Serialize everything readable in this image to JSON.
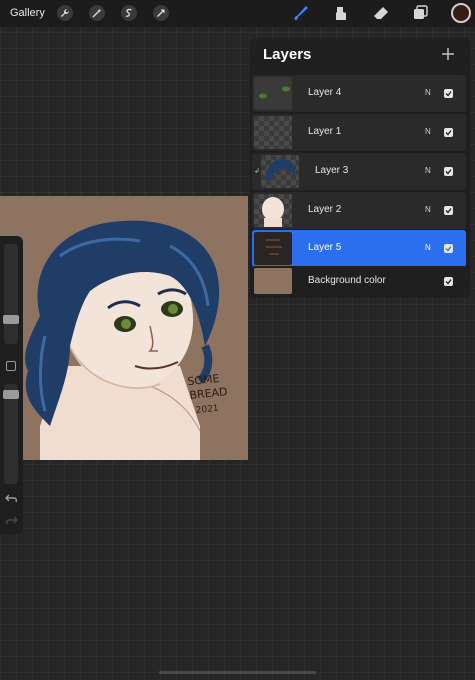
{
  "topbar": {
    "gallery_label": "Gallery",
    "left_tools": [
      "wrench-icon",
      "magic-wand-icon",
      "selection-icon",
      "transform-arrow-icon"
    ],
    "right_tools": [
      "brush-icon",
      "smudge-icon",
      "eraser-icon",
      "layers-icon"
    ],
    "active_tool": "brush-icon",
    "current_color": "#3b1c12"
  },
  "layers_panel": {
    "title": "Layers",
    "add_icon": "plus-icon",
    "layers": [
      {
        "name": "Layer 4",
        "blend": "N",
        "visible": true,
        "active": false
      },
      {
        "name": "Layer 1",
        "blend": "N",
        "visible": true,
        "active": false
      },
      {
        "name": "Layer 3",
        "blend": "N",
        "visible": true,
        "active": false,
        "clipped": true
      },
      {
        "name": "Layer 2",
        "blend": "N",
        "visible": true,
        "active": false
      },
      {
        "name": "Layer 5",
        "blend": "N",
        "visible": true,
        "active": true
      },
      {
        "name": "Background color",
        "visible": true,
        "active": false
      }
    ]
  },
  "artwork": {
    "signature_text": "SOME BREAD 2021",
    "background_color": "#8e7460"
  },
  "colors": {
    "accent": "#2b6ff0",
    "panel": "#1f1f1f"
  }
}
